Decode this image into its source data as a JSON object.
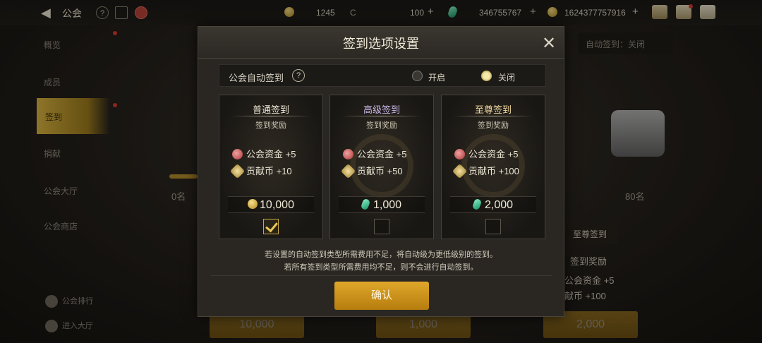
{
  "topbar": {
    "title": "公会",
    "back_glyph": "◀",
    "help_glyph": "?",
    "resources": [
      {
        "value": "1245"
      },
      {
        "value": "100"
      },
      {
        "value": "346755767"
      },
      {
        "value": "1624377757916"
      }
    ],
    "plus": "+",
    "c_mark": "C"
  },
  "sidebar": {
    "items": [
      "概览",
      "成员",
      "签到",
      "捐献",
      "公会大厅",
      "公会商店"
    ],
    "bottom": [
      "公会排行",
      "进入大厅"
    ]
  },
  "background": {
    "auto_signin_status": "自动签到：关闭",
    "rank_left": "0名",
    "rank_right": "80名",
    "supreme_label": "至尊签到",
    "reward_label": "签到奖励",
    "fund_text": "公会资金 +5",
    "contrib_text": "献币 +100",
    "prices": [
      "10,000",
      "1,000",
      "2,000"
    ]
  },
  "dialog": {
    "title": "签到选项设置",
    "close_glyph": "✕",
    "auto_signin_label": "公会自动签到",
    "help_glyph": "?",
    "option_on": "开启",
    "option_off": "关闭",
    "selected_option": "关闭",
    "cards": [
      {
        "title": "普通签到",
        "subtitle": "签到奖励",
        "fund": "公会资金 +5",
        "contrib": "贡献币 +10",
        "price": "10,000",
        "currency": "coin",
        "checked": true
      },
      {
        "title": "高级签到",
        "subtitle": "签到奖励",
        "fund": "公会资金 +5",
        "contrib": "贡献币 +50",
        "price": "1,000",
        "currency": "gem",
        "checked": false
      },
      {
        "title": "至尊签到",
        "subtitle": "签到奖励",
        "fund": "公会资金 +5",
        "contrib": "贡献币 +100",
        "price": "2,000",
        "currency": "gem",
        "checked": false
      }
    ],
    "note_line1": "若设置的自动签到类型所需费用不足，将自动级为更低级别的签到。",
    "note_line2": "若所有签到类型所需费用均不足，则不会进行自动签到。",
    "confirm": "确认"
  },
  "colors": {
    "accent_gold": "#d9a326",
    "gem_green": "#159a6b",
    "notification_red": "#d83a2e"
  }
}
